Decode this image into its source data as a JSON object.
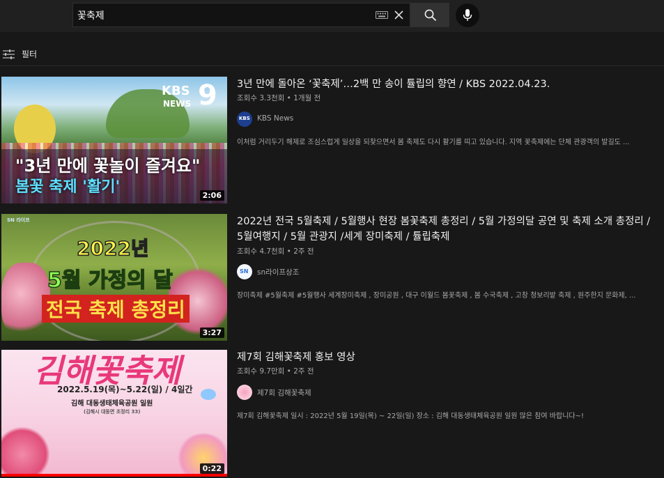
{
  "search": {
    "query": "꽃축제"
  },
  "filter": {
    "label": "필터"
  },
  "results": [
    {
      "title": "3년 만에 돌아온 ‘꽃축제’…2백 만 송이 튤립의 향연 / KBS 2022.04.23.",
      "views": "조회수 3.3천회",
      "age": "1개월 전",
      "channel": "KBS News",
      "description": "이처럼 거리두기 해제로 조심스럽게 일상을 되찾으면서 봄 축제도 다시 활기를 띠고 있습니다. 지역 꽃축제에는 단체 관광객의 발길도 ...",
      "duration": "2:06",
      "thumb_text": {
        "logo_top": "KBS",
        "logo_bottom": "NEWS",
        "logo_num": "9",
        "line1": "\"3년 만에 꽃놀이 즐겨요\"",
        "line2": "봄꽃 축제 '활기'"
      }
    },
    {
      "title": "2022년 전국 5월축제 / 5월행사 현장 봄꽃축제 총정리 / 5월 가정의달 공연 및 축제 소개 총정리 / 5월여행지 / 5월 관광지 /세계 장미축제 / 튤립축제",
      "views": "조회수 4.7천회",
      "age": "2주 전",
      "channel": "sn라이프상조",
      "description": "장미축제 #5월축제 #5월행사 세계장미축제 , 장미공원 , 대구 이월드 봄꽃축제 , 봄 수국축제 , 고창 청보리밭 축제 , 원주한지 문화제, ...",
      "duration": "3:27",
      "thumb_text": {
        "brand": "SN 라이프",
        "line1": "2022년",
        "line2": "5월 가정의 달",
        "line3": "전국 축제 총정리"
      }
    },
    {
      "title": "제7회 김해꽃축제 홍보 영상",
      "views": "조회수 9.7만회",
      "age": "2주 전",
      "channel": "제7회 김해꽃축제",
      "description": "제7회 김해꽃축제 일시 : 2022년 5월 19일(목) ~ 22일(일) 장소 : 김해 대동생태체육공원 일원 많은 참여 바랍니다~!",
      "duration": "0:22",
      "thumb_text": {
        "line1": "김해꽃축제",
        "line2": "2022.5.19(목)~5.22(일) / 4일간",
        "line3": "김해 대동생태체육공원 일원",
        "line4": "(김해시 대동면 초정리 33)"
      }
    }
  ],
  "colors": {
    "background": "#181818",
    "topbar": "#202020",
    "progress_red": "#ff0000",
    "kbs_blue": "#1565c0",
    "banner_yellow": "#ffe24a"
  },
  "icons": {
    "keyboard": "keyboard-icon",
    "clear": "close-icon",
    "search": "search-icon",
    "mic": "mic-icon",
    "filter": "filter-sliders-icon"
  }
}
